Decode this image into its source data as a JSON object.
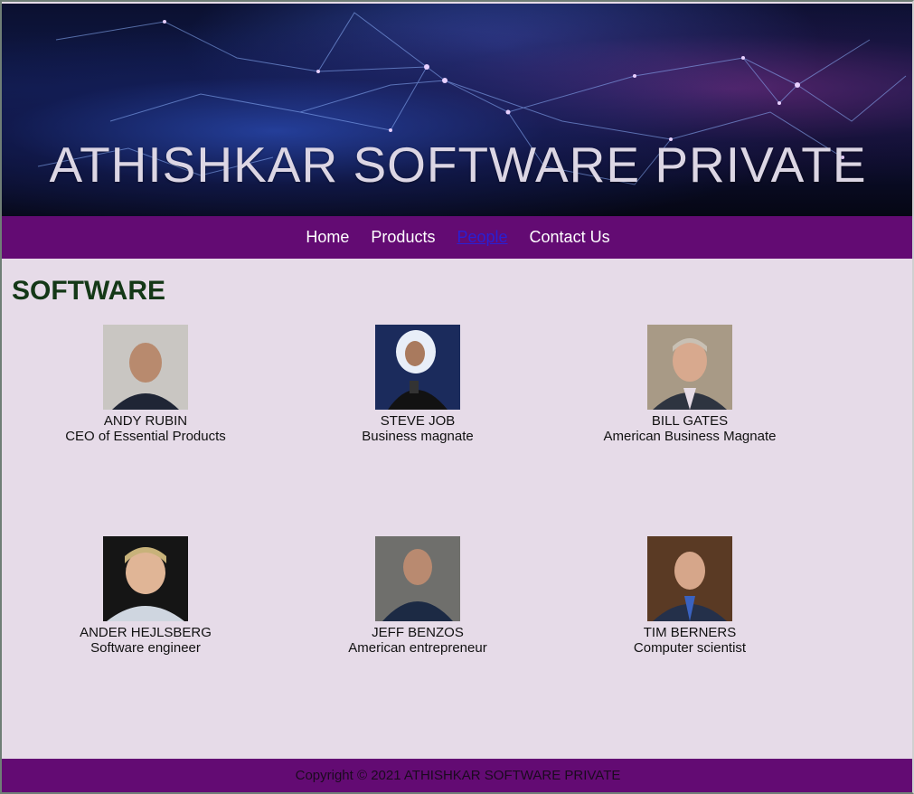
{
  "banner": {
    "title": "ATHISHKAR SOFTWARE PRIVATE"
  },
  "nav": {
    "items": [
      {
        "label": "Home"
      },
      {
        "label": "Products"
      },
      {
        "label": "People",
        "active": true
      },
      {
        "label": "Contact Us"
      }
    ]
  },
  "section": {
    "title": "SOFTWARE"
  },
  "people": [
    {
      "name": "ANDY RUBIN",
      "role": "CEO of Essential Products"
    },
    {
      "name": "STEVE JOB",
      "role": "Business magnate"
    },
    {
      "name": "BILL GATES",
      "role": "American Business Magnate"
    },
    {
      "name": "ANDER HEJLSBERG",
      "role": "Software engineer"
    },
    {
      "name": "JEFF BENZOS",
      "role": "American entrepreneur"
    },
    {
      "name": "TIM BERNERS",
      "role": "Computer scientist"
    }
  ],
  "footer": {
    "text": "Copyright © 2021 ATHISHKAR SOFTWARE PRIVATE"
  },
  "colors": {
    "nav_bg": "#630b73",
    "page_bg": "#e6dbe8",
    "title": "#143817",
    "active_link": "#2a1fd4"
  }
}
